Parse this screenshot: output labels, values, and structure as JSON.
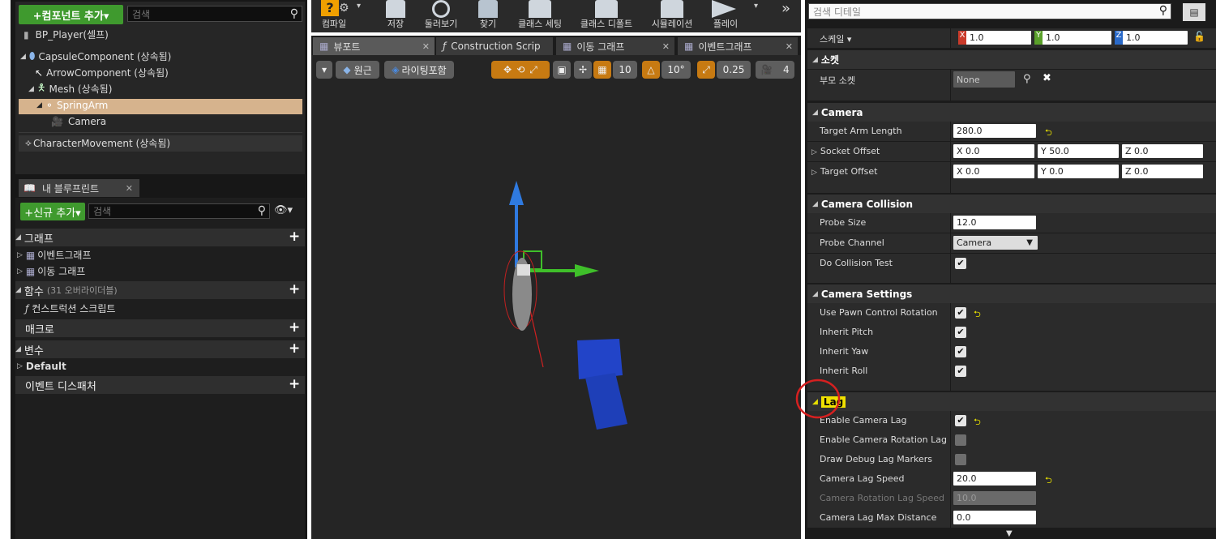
{
  "components": {
    "add_button": "+컴포넌트 추가▾",
    "search_placeholder": "검색",
    "root": "BP_Player(셀프)",
    "items": [
      {
        "label": "CapsuleComponent (상속됨)"
      },
      {
        "label": "ArrowComponent (상속됨)"
      },
      {
        "label": "Mesh (상속됨)"
      },
      {
        "label": "SpringArm"
      },
      {
        "label": "Camera"
      },
      {
        "label": "CharacterMovement (상속됨)"
      }
    ]
  },
  "my_blueprint": {
    "tab_label": "내 블루프린트",
    "add_button": "+신규 추가▾",
    "search_placeholder": "검색",
    "sections": {
      "graph": "그래프",
      "event_graph": "이벤트그래프",
      "move_graph": "이동 그래프",
      "functions": "함수",
      "functions_note": "(31 오버라이더블)",
      "construction_script": "컨스트럭션 스크립트",
      "macro": "매크로",
      "variables": "변수",
      "default": "Default",
      "event_dispatcher": "이벤트 디스패처"
    }
  },
  "toolbar": {
    "items": [
      "컴파일",
      "저장",
      "둘러보기",
      "찾기",
      "클래스 세팅",
      "클래스 디폴트",
      "시뮬레이션",
      "플레이"
    ]
  },
  "tabs": [
    "뷰포트",
    "Construction Scrip",
    "이동 그래프",
    "이벤트그래프"
  ],
  "viewport": {
    "perspective": "원근",
    "lighting": "라이팅포함",
    "grid_snap": "10",
    "rotation_snap": "10°",
    "scale_snap": "0.25",
    "camera_speed": "4"
  },
  "details": {
    "search_placeholder": "검색 디테일",
    "scale_label": "스케일 ▾",
    "scale": {
      "x": "1.0",
      "y": "1.0",
      "z": "1.0"
    },
    "socket_category": "소켓",
    "parent_socket_label": "부모 소켓",
    "parent_socket_value": "None",
    "camera": {
      "category": "Camera",
      "target_arm_length_label": "Target Arm Length",
      "target_arm_length": "280.0",
      "socket_offset_label": "Socket Offset",
      "socket_offset": {
        "x": "0.0",
        "y": "50.0",
        "z": "0.0"
      },
      "target_offset_label": "Target Offset",
      "target_offset": {
        "x": "0.0",
        "y": "0.0",
        "z": "0.0"
      }
    },
    "collision": {
      "category": "Camera Collision",
      "probe_size_label": "Probe Size",
      "probe_size": "12.0",
      "probe_channel_label": "Probe Channel",
      "probe_channel": "Camera",
      "do_collision_test_label": "Do Collision Test"
    },
    "settings": {
      "category": "Camera Settings",
      "use_pawn_control_rotation": "Use Pawn Control Rotation",
      "inherit_pitch": "Inherit Pitch",
      "inherit_yaw": "Inherit Yaw",
      "inherit_roll": "Inherit Roll"
    },
    "lag": {
      "category": "Lag",
      "enable_camera_lag": "Enable Camera Lag",
      "enable_camera_rotation_lag": "Enable Camera Rotation Lag",
      "draw_debug_lag_markers": "Draw Debug Lag Markers",
      "camera_lag_speed_label": "Camera Lag Speed",
      "camera_lag_speed": "20.0",
      "camera_rotation_lag_speed_label": "Camera Rotation Lag Speed",
      "camera_rotation_lag_speed": "10.0",
      "camera_lag_max_distance_label": "Camera Lag Max Distance",
      "camera_lag_max_distance": "0.0"
    }
  },
  "axis_labels": {
    "x": "X",
    "y": "Y",
    "z": "Z"
  },
  "colors": {
    "green": "#3f9a2e",
    "selected": "#d6b38d",
    "annotation": "#d62020",
    "highlight": "#e8e000"
  }
}
